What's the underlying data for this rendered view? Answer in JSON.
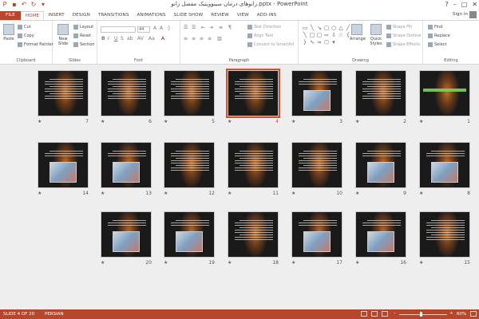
{
  "window": {
    "title": "زانوهای درمان سینوویتیک مفصل زانو.pptx - PowerPoint",
    "controls": [
      "?",
      "–",
      "□",
      "✕"
    ]
  },
  "tabs": [
    {
      "label": "FILE",
      "kind": "file"
    },
    {
      "label": "HOME",
      "kind": "active"
    },
    {
      "label": "INSERT",
      "kind": ""
    },
    {
      "label": "DESIGN",
      "kind": ""
    },
    {
      "label": "TRANSITIONS",
      "kind": ""
    },
    {
      "label": "ANIMATIONS",
      "kind": ""
    },
    {
      "label": "SLIDE SHOW",
      "kind": ""
    },
    {
      "label": "REVIEW",
      "kind": ""
    },
    {
      "label": "VIEW",
      "kind": ""
    },
    {
      "label": "ADD-INS",
      "kind": ""
    }
  ],
  "signin": "Sign in",
  "ribbon": {
    "clipboard": {
      "label": "Clipboard",
      "paste": "Paste",
      "cut": "Cut",
      "copy": "Copy",
      "format_painter": "Format Painter"
    },
    "slides": {
      "label": "Slides",
      "new_slide": "New Slide",
      "layout": "Layout",
      "reset": "Reset",
      "section": "Section"
    },
    "font": {
      "label": "Font",
      "size": "44"
    },
    "paragraph": {
      "label": "Paragraph",
      "text_direction": "Text Direction",
      "align_text": "Align Text",
      "convert": "Convert to SmartArt"
    },
    "drawing": {
      "label": "Drawing",
      "arrange": "Arrange",
      "quick_styles": "Quick Styles",
      "shape_fill": "Shape Fill",
      "shape_outline": "Shape Outline",
      "shape_effects": "Shape Effects"
    },
    "editing": {
      "label": "Editing",
      "find": "Find",
      "replace": "Replace",
      "select": "Select"
    }
  },
  "slides": [
    {
      "num": "1",
      "star": "★",
      "variant": "title",
      "selected": false
    },
    {
      "num": "2",
      "star": "★",
      "variant": "text",
      "selected": false
    },
    {
      "num": "3",
      "star": "★",
      "variant": "image",
      "selected": false
    },
    {
      "num": "4",
      "star": "★",
      "variant": "text",
      "selected": true
    },
    {
      "num": "5",
      "star": "★",
      "variant": "text",
      "selected": false
    },
    {
      "num": "6",
      "star": "★",
      "variant": "text",
      "selected": false
    },
    {
      "num": "7",
      "star": "★",
      "variant": "text",
      "selected": false
    },
    {
      "num": "8",
      "star": "★",
      "variant": "image",
      "selected": false
    },
    {
      "num": "9",
      "star": "★",
      "variant": "image",
      "selected": false
    },
    {
      "num": "10",
      "star": "★",
      "variant": "text",
      "selected": false
    },
    {
      "num": "11",
      "star": "★",
      "variant": "text",
      "selected": false
    },
    {
      "num": "12",
      "star": "★",
      "variant": "text",
      "selected": false
    },
    {
      "num": "13",
      "star": "★",
      "variant": "image",
      "selected": false
    },
    {
      "num": "14",
      "star": "★",
      "variant": "image",
      "selected": false
    },
    {
      "num": "15",
      "star": "★",
      "variant": "text",
      "selected": false
    },
    {
      "num": "16",
      "star": "★",
      "variant": "image",
      "selected": false
    },
    {
      "num": "17",
      "star": "★",
      "variant": "image",
      "selected": false
    },
    {
      "num": "18",
      "star": "★",
      "variant": "text",
      "selected": false
    },
    {
      "num": "19",
      "star": "★",
      "variant": "image",
      "selected": false
    },
    {
      "num": "20",
      "star": "★",
      "variant": "image",
      "selected": false
    }
  ],
  "status": {
    "slide_info": "SLIDE 4 OF 20",
    "language": "PERSIAN",
    "zoom_minus": "–",
    "zoom_plus": "+",
    "zoom": "60%"
  },
  "colors": {
    "accent": "#b7472a",
    "selection": "#d35230"
  }
}
